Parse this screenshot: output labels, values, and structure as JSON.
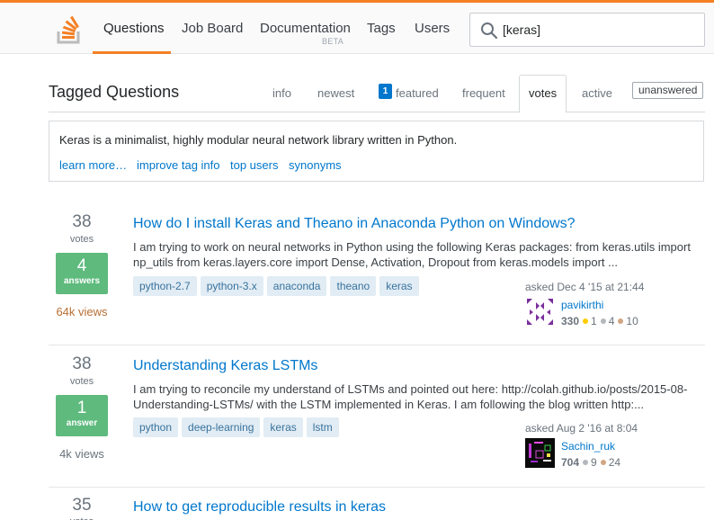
{
  "topbar": {
    "nav": [
      {
        "label": "Questions",
        "active": true
      },
      {
        "label": "Job Board"
      },
      {
        "label": "Documentation",
        "badge": "BETA"
      },
      {
        "label": "Tags"
      },
      {
        "label": "Users"
      }
    ],
    "search_value": "[keras]",
    "logo_icon": "stack-overflow-logo-icon",
    "accent_color": "#f48024"
  },
  "page": {
    "title": "Tagged Questions",
    "tabs": [
      {
        "label": "info"
      },
      {
        "label": "newest"
      },
      {
        "label": "featured",
        "badge": "1"
      },
      {
        "label": "frequent"
      },
      {
        "label": "votes",
        "active": true
      },
      {
        "label": "active"
      },
      {
        "label": "unanswered"
      }
    ]
  },
  "wiki": {
    "text": "Keras is a minimalist, highly modular neural network library written in Python.",
    "links": [
      "learn more…",
      "improve tag info",
      "top users",
      "synonyms"
    ]
  },
  "questions": [
    {
      "votes": "38",
      "votes_label": "votes",
      "answers": "4",
      "answers_label": "answers",
      "views": "64k views",
      "views_color": "#b86f34",
      "title": "How do I install Keras and Theano in Anaconda Python on Windows?",
      "excerpt": "I am trying to work on neural networks in Python using the following Keras packages: from keras.utils import np_utils from keras.layers.core import Dense, Activation, Dropout from keras.models import ...",
      "tags": [
        "python-2.7",
        "python-3.x",
        "anaconda",
        "theano",
        "keras"
      ],
      "asked": "asked Dec 4 '15 at 21:44",
      "user": "pavikirthi",
      "rep": "330",
      "gold": "1",
      "silver": "4",
      "bronze": "10"
    },
    {
      "votes": "38",
      "votes_label": "votes",
      "answers": "1",
      "answers_label": "answer",
      "views": "4k views",
      "views_color": "#6a737c",
      "title": "Understanding Keras LSTMs",
      "excerpt": "I am trying to reconcile my understand of LSTMs and pointed out here: http://colah.github.io/posts/2015-08-Understanding-LSTMs/ with the LSTM implemented in Keras. I am following the blog written http:...",
      "tags": [
        "python",
        "deep-learning",
        "keras",
        "lstm"
      ],
      "asked": "asked Aug 2 '16 at 8:04",
      "user": "Sachin_ruk",
      "rep": "704",
      "silver": "9",
      "bronze": "24"
    },
    {
      "votes": "35",
      "votes_label": "votes",
      "title": "How to get reproducible results in keras"
    }
  ],
  "badge_colors": {
    "gold": "#ffcc01",
    "silver": "#b4b8bc",
    "bronze": "#d1a684"
  }
}
